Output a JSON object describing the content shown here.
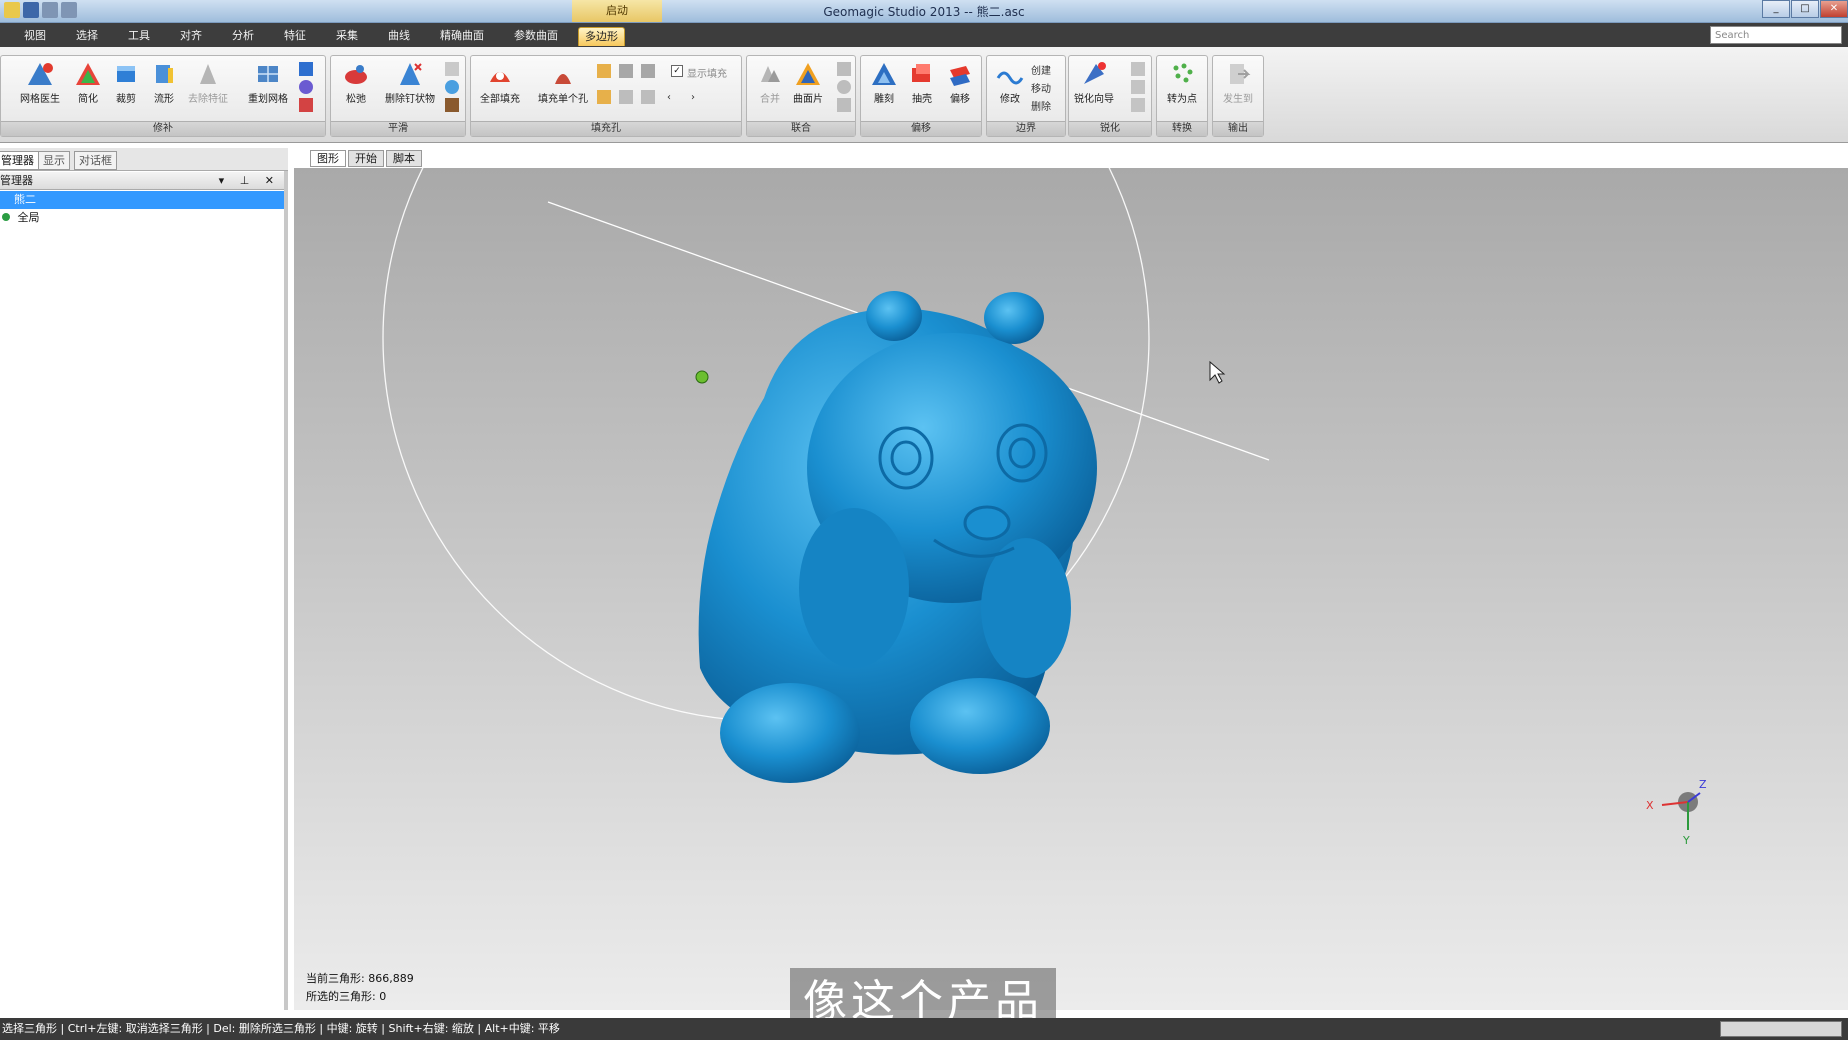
{
  "app": {
    "title": "Geomagic Studio 2013 -- 熊二.asc",
    "context_tab": "启动"
  },
  "menu_tabs": [
    "视图",
    "选择",
    "工具",
    "对齐",
    "分析",
    "特征",
    "采集",
    "曲线",
    "精确曲面",
    "参数曲面",
    "多边形"
  ],
  "active_tab_index": 10,
  "search": {
    "placeholder": "Search"
  },
  "ribbon": {
    "groups": [
      {
        "label": "修补",
        "buttons": [
          "网格医生",
          "简化",
          "裁剪",
          "流形",
          "去除特征",
          "重划网格"
        ]
      },
      {
        "label": "平滑",
        "buttons": [
          "松弛",
          "删除钉状物"
        ]
      },
      {
        "label": "填充孔",
        "buttons": [
          "全部填充",
          "填充单个孔"
        ],
        "checkbox": "显示填充"
      },
      {
        "label": "联合",
        "buttons": [
          "合并",
          "曲面片"
        ]
      },
      {
        "label": "偏移",
        "buttons": [
          "雕刻",
          "抽壳",
          "偏移"
        ]
      },
      {
        "label": "边界",
        "buttons": [
          "修改"
        ],
        "menu": [
          "创建",
          "移动",
          "删除"
        ]
      },
      {
        "label": "锐化",
        "buttons": [
          "锐化向导"
        ]
      },
      {
        "label": "转换",
        "buttons": [
          "转为点"
        ]
      },
      {
        "label": "输出",
        "buttons": [
          "发生到"
        ]
      }
    ]
  },
  "left_panel": {
    "tabs": [
      "管理器",
      "显示",
      "对话框"
    ],
    "header": "管理器",
    "tree": [
      {
        "label": "熊二",
        "selected": true
      },
      {
        "label": "全局",
        "selected": false
      }
    ]
  },
  "view_tabs": [
    "图形",
    "开始",
    "脚本"
  ],
  "viewport": {
    "current_triangles": "当前三角形: 866,889",
    "selected_triangles": "所选的三角形: 0",
    "axis_x": "X",
    "axis_y": "Y",
    "axis_z": "Z",
    "model_color": "#1a8fd0"
  },
  "subtitle": "像这个产品",
  "status": "选择三角形 | Ctrl+左键: 取消选择三角形 | Del: 删除所选三角形 | 中键: 旋转 | Shift+右键: 缩放 | Alt+中键: 平移"
}
